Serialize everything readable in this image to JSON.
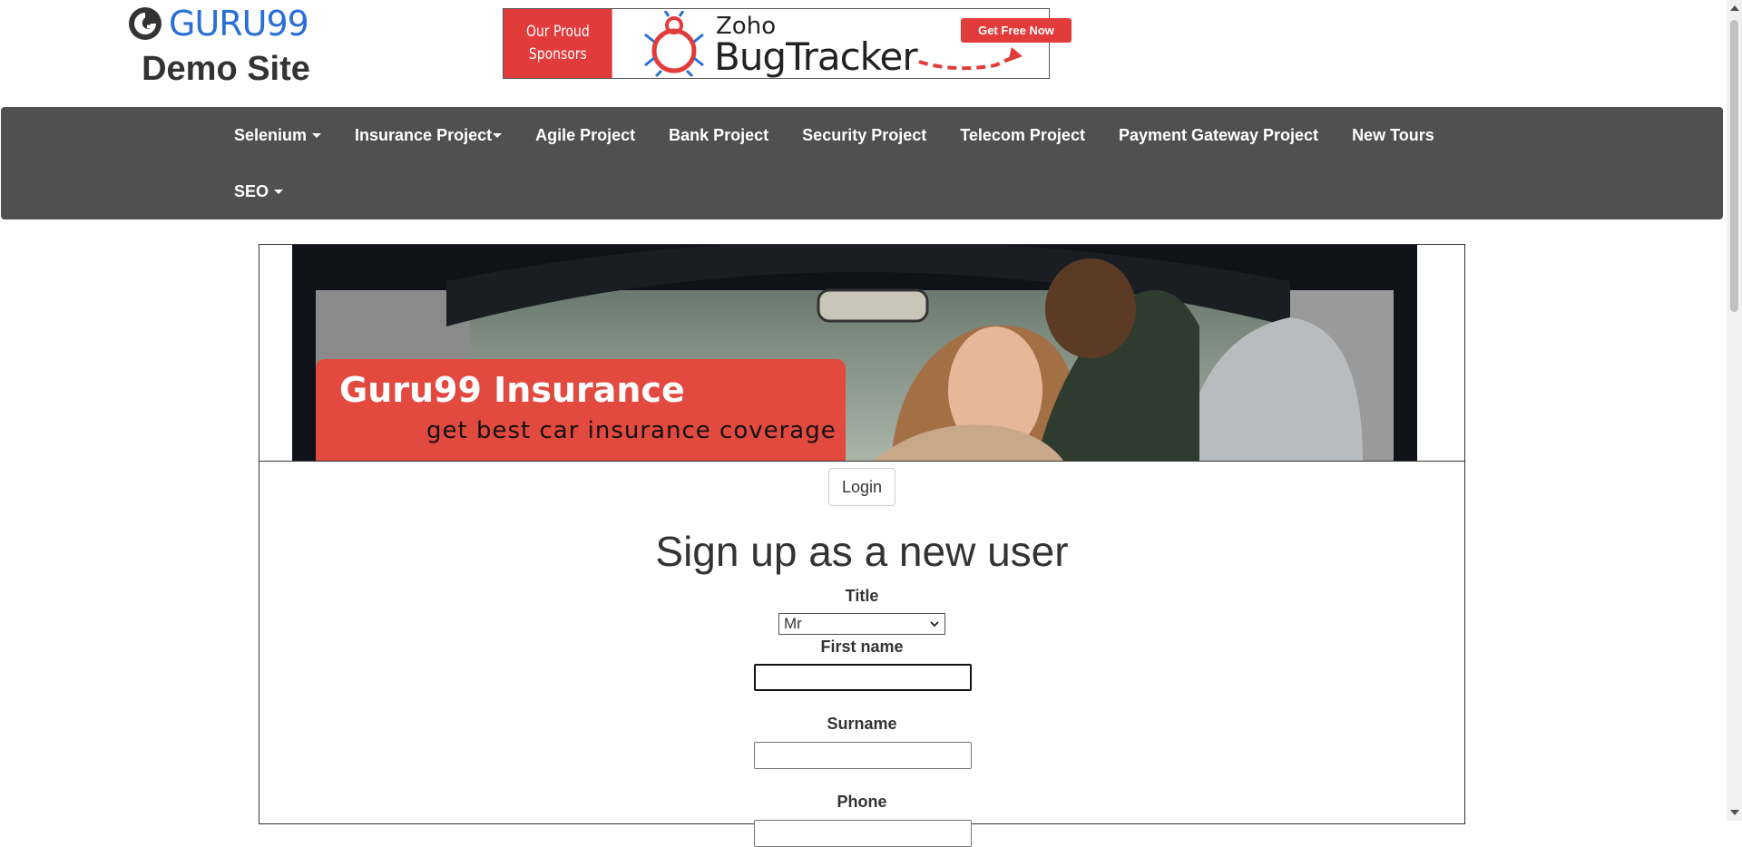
{
  "logo": {
    "text": "GURU99",
    "subtitle": "Demo Site"
  },
  "sponsor": {
    "left_line1": "Our Proud",
    "left_line2": "Sponsors",
    "brand_small": "Zoho",
    "brand_large": "BugTracker",
    "cta": "Get Free Now"
  },
  "nav": {
    "row1": [
      {
        "label": "Selenium",
        "dropdown": true
      },
      {
        "label": "Insurance Project",
        "dropdown": true
      },
      {
        "label": "Agile Project",
        "dropdown": false
      },
      {
        "label": "Bank Project",
        "dropdown": false
      },
      {
        "label": "Security Project",
        "dropdown": false
      },
      {
        "label": "Telecom Project",
        "dropdown": false
      },
      {
        "label": "Payment Gateway Project",
        "dropdown": false
      },
      {
        "label": "New Tours",
        "dropdown": false
      }
    ],
    "row2": [
      {
        "label": "SEO",
        "dropdown": true
      }
    ]
  },
  "banner": {
    "title": "Guru99 Insurance",
    "subtitle": "get best car insurance coverage"
  },
  "form": {
    "login_label": "Login",
    "heading": "Sign up as a new user",
    "title_label": "Title",
    "title_value": "Mr",
    "first_name_label": "First name",
    "first_name_value": "",
    "surname_label": "Surname",
    "surname_value": "",
    "phone_label": "Phone",
    "phone_value": ""
  },
  "colors": {
    "nav_bg": "#505050",
    "brand_blue": "#2a6fd6",
    "sponsor_red": "#e23b3b",
    "banner_red": "#e2493f"
  },
  "icons": [
    "guru99-logo-icon",
    "bug-icon",
    "caret-down-icon",
    "chevron-down-icon"
  ]
}
